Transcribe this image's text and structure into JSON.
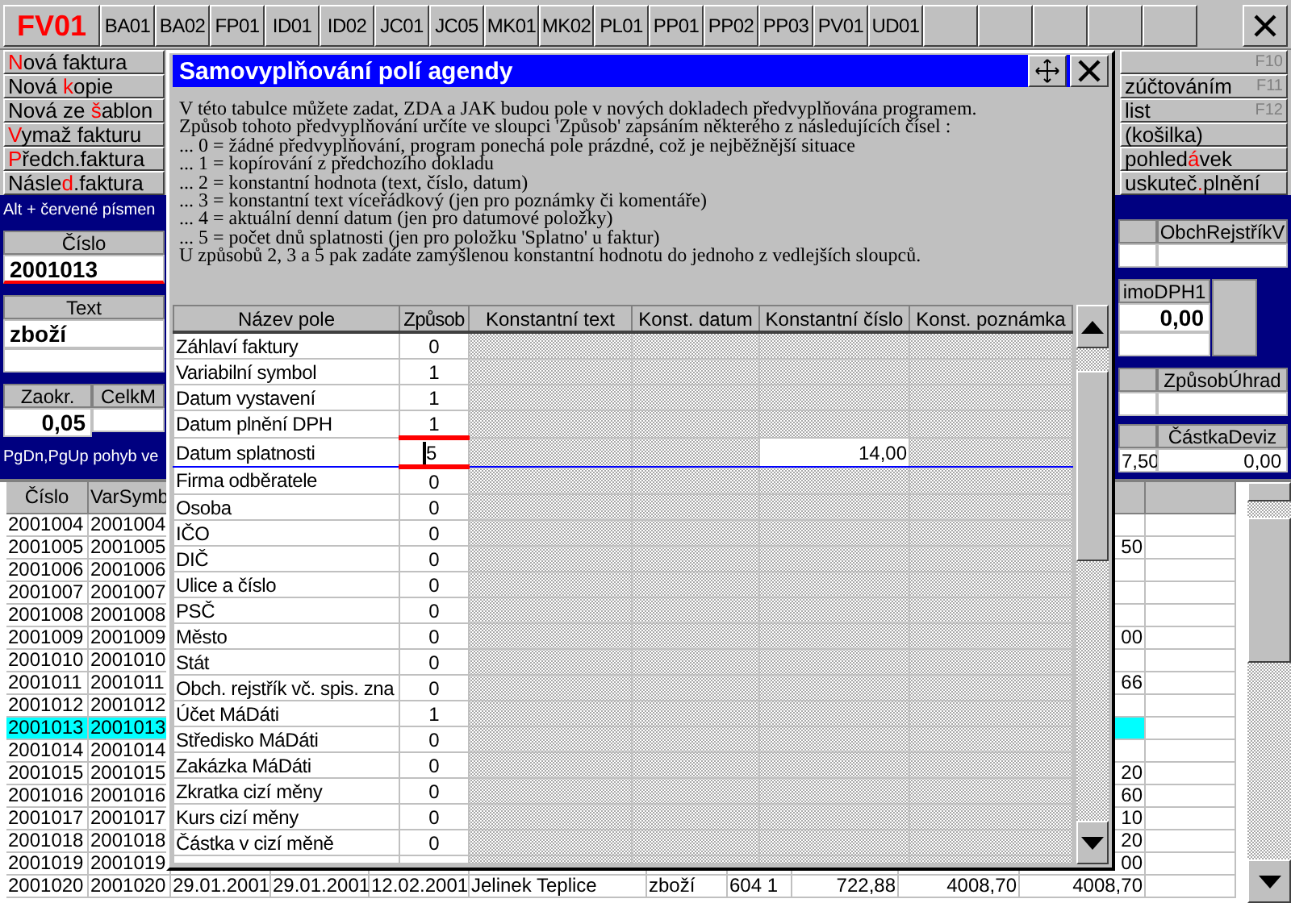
{
  "tabs": [
    {
      "label": "FV01",
      "selected": true
    },
    {
      "label": "BA01",
      "selected": false
    },
    {
      "label": "BA02",
      "selected": false
    },
    {
      "label": "FP01",
      "selected": false
    },
    {
      "label": "ID01",
      "selected": false
    },
    {
      "label": "ID02",
      "selected": false
    },
    {
      "label": "JC01",
      "selected": false
    },
    {
      "label": "JC05",
      "selected": false
    },
    {
      "label": "MK01",
      "selected": false
    },
    {
      "label": "MK02",
      "selected": false
    },
    {
      "label": "PL01",
      "selected": false
    },
    {
      "label": "PP01",
      "selected": false
    },
    {
      "label": "PP02",
      "selected": false
    },
    {
      "label": "PP03",
      "selected": false
    },
    {
      "label": "PV01",
      "selected": false
    },
    {
      "label": "UD01",
      "selected": false
    }
  ],
  "left_menu": [
    {
      "key": "N",
      "post": "ová faktura"
    },
    {
      "pre": "Nová ",
      "key": "k",
      "post": "opie"
    },
    {
      "pre": "Nová ze ",
      "key": "š",
      "post": "ablon"
    },
    {
      "key": "V",
      "post": "ymaž fakturu"
    },
    {
      "key": "P",
      "post": "ředch.faktura"
    },
    {
      "pre": "Násle",
      "key": "d",
      "post": ".faktura"
    }
  ],
  "right_menu": [
    {
      "shortcut": "F10"
    },
    {
      "post": "zúčtováním",
      "shortcut": "F11"
    },
    {
      "post": "list",
      "shortcut": "F12"
    },
    {
      "post": "(košilka)"
    },
    {
      "pre": " pohled",
      "key": "á",
      "post": "vek"
    },
    {
      "pre": " uskuteč",
      "key": ".",
      "post": "plnění"
    }
  ],
  "record_panel": {
    "hint": "Alt + červené písmen",
    "number_label": "Číslo",
    "number_value": "2001013",
    "text_label": "Text",
    "text_value": "zboží",
    "rounding_label": "Zaokr.",
    "rounding_value": "0,05",
    "total_label": "CelkM",
    "footer_hint": "PgDn,PgUp pohyb ve",
    "register_label": "ObchRejstříkV",
    "vat_label": "imoDPH1",
    "vat_value": "0,00",
    "payment_label": "ZpůsobÚhrad",
    "currency_amount_label": "ČástkaDeviz",
    "column_left_value": "7,50",
    "currency_amount_value": "0,00"
  },
  "table": {
    "columns": [
      "Číslo",
      "VarSymb"
    ],
    "rows": [
      {
        "cells": [
          "2001004",
          "2001004"
        ],
        "selected": false
      },
      {
        "cells": [
          "2001005",
          "2001005"
        ],
        "column_11": "50",
        "selected": false
      },
      {
        "cells": [
          "2001006",
          "2001006"
        ],
        "selected": false
      },
      {
        "cells": [
          "2001007",
          "2001007"
        ],
        "selected": false
      },
      {
        "cells": [
          "2001008",
          "2001008"
        ],
        "selected": false
      },
      {
        "cells": [
          "2001009",
          "2001009"
        ],
        "column_11": "00",
        "selected": false
      },
      {
        "cells": [
          "2001010",
          "2001010"
        ],
        "selected": false
      },
      {
        "cells": [
          "2001011",
          "2001011"
        ],
        "column_11": "66",
        "selected": false
      },
      {
        "cells": [
          "2001012",
          "2001012"
        ],
        "selected": false
      },
      {
        "cells": [
          "2001013",
          "2001013"
        ],
        "selected": true
      },
      {
        "cells": [
          "2001014",
          "2001014"
        ],
        "selected": false
      },
      {
        "cells": [
          "2001015",
          "2001015"
        ],
        "column_11": "20",
        "selected": false
      },
      {
        "cells": [
          "2001016",
          "2001016"
        ],
        "column_11": "60",
        "selected": false
      },
      {
        "cells": [
          "2001017",
          "2001017"
        ],
        "column_11": "10",
        "selected": false
      },
      {
        "cells": [
          "2001018",
          "2001018"
        ],
        "column_11": "20",
        "selected": false
      },
      {
        "cells": [
          "2001019",
          "2001019"
        ],
        "column_11": "00",
        "selected": false
      },
      {
        "cells": [
          "2001020",
          "2001020",
          "29.01.2001",
          "29.01.2001",
          "12.02.2001",
          "Jelinek Teplice",
          "zboží",
          "604 1",
          "722,88",
          "4008,70",
          "4008,70"
        ],
        "selected": false
      }
    ]
  },
  "dialog": {
    "title": "Samovyplňování polí agendy",
    "description": [
      "V této tabulce můžete zadat, ZDA a JAK budou pole v nových dokladech předvyplňována programem.",
      "Způsob tohoto předvyplňování určíte ve sloupci 'Způsob' zapsáním některého z následujících čísel :",
      "... 0 = žádné předvyplňování, program ponechá pole prázdné, což je nejběžnější situace",
      "... 1 = kopírování z předchozího dokladu",
      "... 2 = konstantní hodnota (text, číslo, datum)",
      "... 3 = konstantní text víceřádkový (jen pro poznámky či komentáře)",
      "... 4 = aktuální denní datum (jen pro datumové položky)",
      "... 5 = počet dnů splatnosti (jen pro položku 'Splatno' u faktur)",
      "U způsobů 2, 3 a 5 pak zadáte zamýšlenou konstantní hodnotu do jednoho z vedlejších sloupců."
    ],
    "columns": [
      "Název pole",
      "Způsob",
      "Konstantní text",
      "Konst. datum",
      "Konstantní číslo",
      "Konst. poznámka"
    ],
    "rows": [
      {
        "name": "Záhlaví faktury",
        "mode": "0",
        "selected": false
      },
      {
        "name": "Variabilní symbol",
        "mode": "1",
        "selected": false
      },
      {
        "name": "Datum vystavení",
        "mode": "1",
        "selected": false
      },
      {
        "name": "Datum plnění DPH",
        "mode": "1",
        "selected": false
      },
      {
        "name": "Datum splatnosti",
        "mode": "5",
        "constant_number": "14,00",
        "selected": true
      },
      {
        "name": "Firma odběratele",
        "mode": "0",
        "selected": false
      },
      {
        "name": "Osoba",
        "mode": "0",
        "selected": false
      },
      {
        "name": "IČO",
        "mode": "0",
        "selected": false
      },
      {
        "name": "DIČ",
        "mode": "0",
        "selected": false
      },
      {
        "name": "Ulice a číslo",
        "mode": "0",
        "selected": false
      },
      {
        "name": "PSČ",
        "mode": "0",
        "selected": false
      },
      {
        "name": "Město",
        "mode": "0",
        "selected": false
      },
      {
        "name": "Stát",
        "mode": "0",
        "selected": false
      },
      {
        "name": "Obch. rejstřík vč. spis. zna",
        "mode": "0",
        "selected": false
      },
      {
        "name": "Účet MáDáti",
        "mode": "1",
        "selected": false
      },
      {
        "name": "Středisko MáDáti",
        "mode": "0",
        "selected": false
      },
      {
        "name": "Zakázka MáDáti",
        "mode": "0",
        "selected": false
      },
      {
        "name": "Zkratka cizí měny",
        "mode": "0",
        "selected": false
      },
      {
        "name": "Kurs cizí měny",
        "mode": "0",
        "selected": false
      },
      {
        "name": "Částka v cizí měně",
        "mode": "0",
        "selected": false
      }
    ]
  }
}
